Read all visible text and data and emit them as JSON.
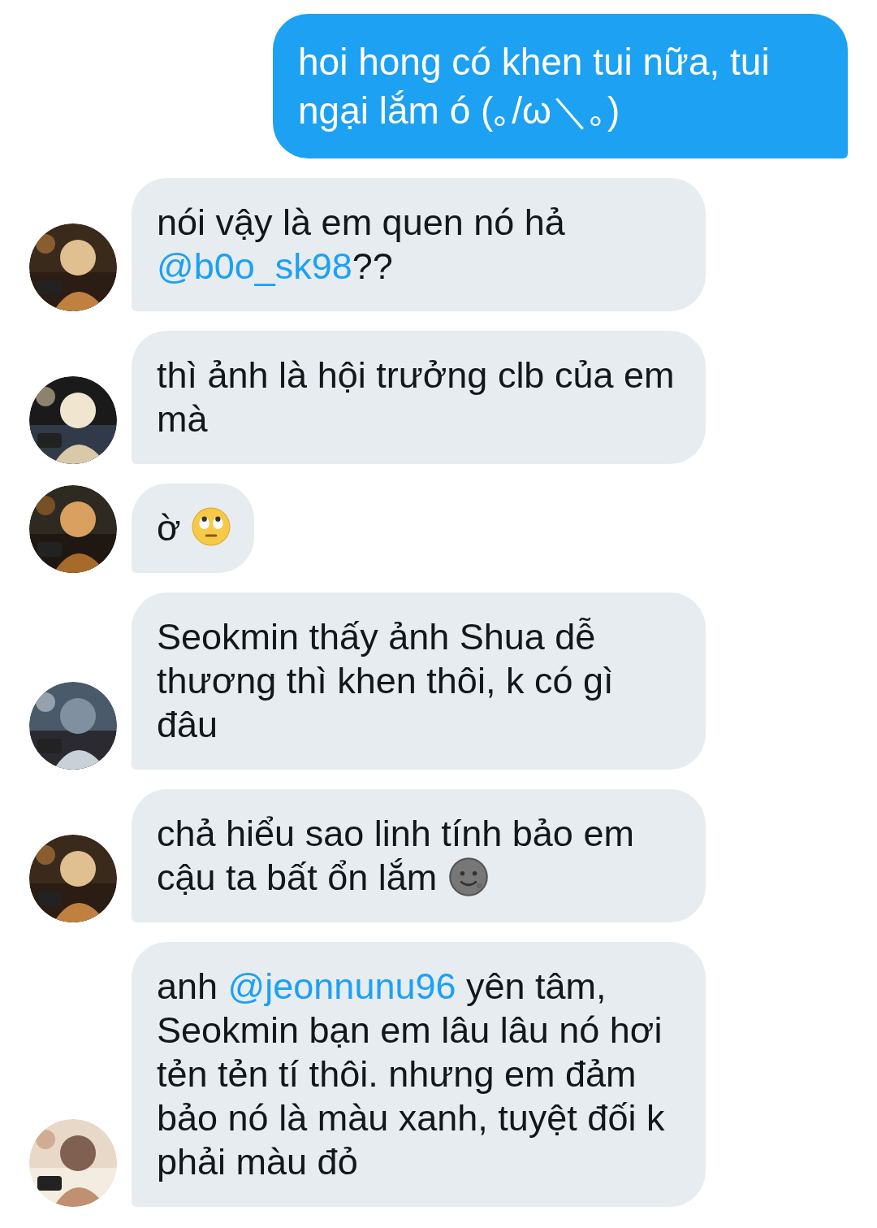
{
  "messages": [
    {
      "kind": "sent",
      "parts": [
        {
          "kind": "text",
          "text": "hoi hong có khen tui nữa, tui ngại lắm ó (｡/ω＼｡)"
        }
      ]
    },
    {
      "kind": "received",
      "parts": [
        {
          "kind": "text",
          "text": "nói vậy là em quen nó hả "
        },
        {
          "kind": "mention",
          "text": "@b0o_sk98"
        },
        {
          "kind": "text",
          "text": "??"
        }
      ]
    },
    {
      "kind": "received",
      "parts": [
        {
          "kind": "text",
          "text": "thì ảnh là hội trưởng clb của em mà"
        }
      ]
    },
    {
      "kind": "received",
      "parts": [
        {
          "kind": "text",
          "text": "ờ "
        },
        {
          "kind": "eyeroll"
        }
      ]
    },
    {
      "kind": "received",
      "parts": [
        {
          "kind": "text",
          "text": "Seokmin thấy ảnh Shua dễ thương thì khen thôi, k có gì đâu"
        }
      ]
    },
    {
      "kind": "received",
      "parts": [
        {
          "kind": "text",
          "text": "chả hiểu sao linh tính bảo em cậu ta bất ổn lắm "
        },
        {
          "kind": "moon"
        }
      ]
    },
    {
      "kind": "received",
      "parts": [
        {
          "kind": "text",
          "text": "anh "
        },
        {
          "kind": "mention",
          "text": "@jeonnunu96"
        },
        {
          "kind": "text",
          "text": " yên tâm, Seokmin bạn em lâu lâu nó hơi tẻn tẻn tí thôi. nhưng em đảm bảo nó là màu xanh, tuyệt đối k phải màu đỏ"
        }
      ]
    }
  ]
}
